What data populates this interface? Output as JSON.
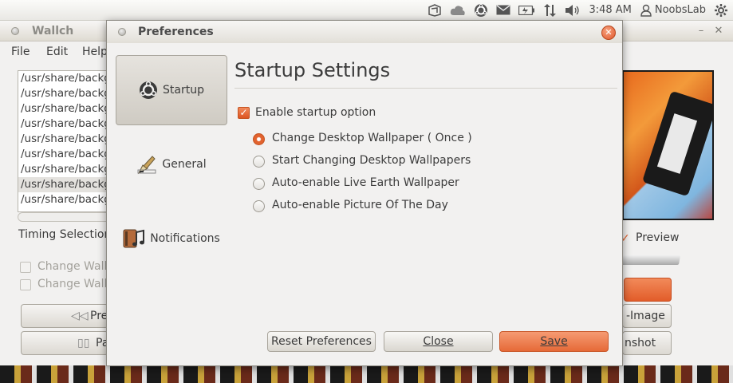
{
  "panel": {
    "time": "3:48 AM",
    "user": "NoobsLab",
    "icons": [
      "dropbox-icon",
      "cloud-icon",
      "ubuntu-one-icon",
      "mail-icon",
      "battery-icon",
      "network-icon",
      "volume-icon",
      "user-icon",
      "gear-icon"
    ]
  },
  "wallch": {
    "title": "Wallch",
    "menu": [
      "File",
      "Edit",
      "Help"
    ],
    "paths": [
      "/usr/share/backg",
      "/usr/share/backg",
      "/usr/share/backg",
      "/usr/share/backg",
      "/usr/share/backg",
      "/usr/share/backg",
      "/usr/share/backg",
      "/usr/share/backg",
      "/usr/share/backg"
    ],
    "timing_label": "Timing Selection",
    "change_wallp_1": "Change Wallp",
    "change_wallp_2": "Change Wallp",
    "prev_label": "Pre",
    "pause_label": "Pa",
    "preview_label": "Preview",
    "image_label": "-Image",
    "shot_label": "nshot"
  },
  "dialog": {
    "title": "Preferences",
    "categories": [
      {
        "label": "Startup",
        "icon": "ubuntu-logo-icon"
      },
      {
        "label": "General",
        "icon": "brush-icon"
      },
      {
        "label": "Notifications",
        "icon": "music-notes-icon"
      }
    ],
    "heading": "Startup Settings",
    "enable_label": "Enable startup option",
    "enable_checked": true,
    "options": [
      {
        "label": "Change Desktop Wallpaper ( Once )",
        "selected": true
      },
      {
        "label": "Start Changing Desktop Wallpapers",
        "selected": false
      },
      {
        "label": "Auto-enable Live Earth Wallpaper",
        "selected": false
      },
      {
        "label": "Auto-enable Picture Of The Day",
        "selected": false
      }
    ],
    "buttons": {
      "reset": "Reset Preferences",
      "close": "Close",
      "save": "Save"
    }
  },
  "colors": {
    "accent": "#e66a38",
    "panel": "#efeeea",
    "window": "#f2f1f0"
  }
}
